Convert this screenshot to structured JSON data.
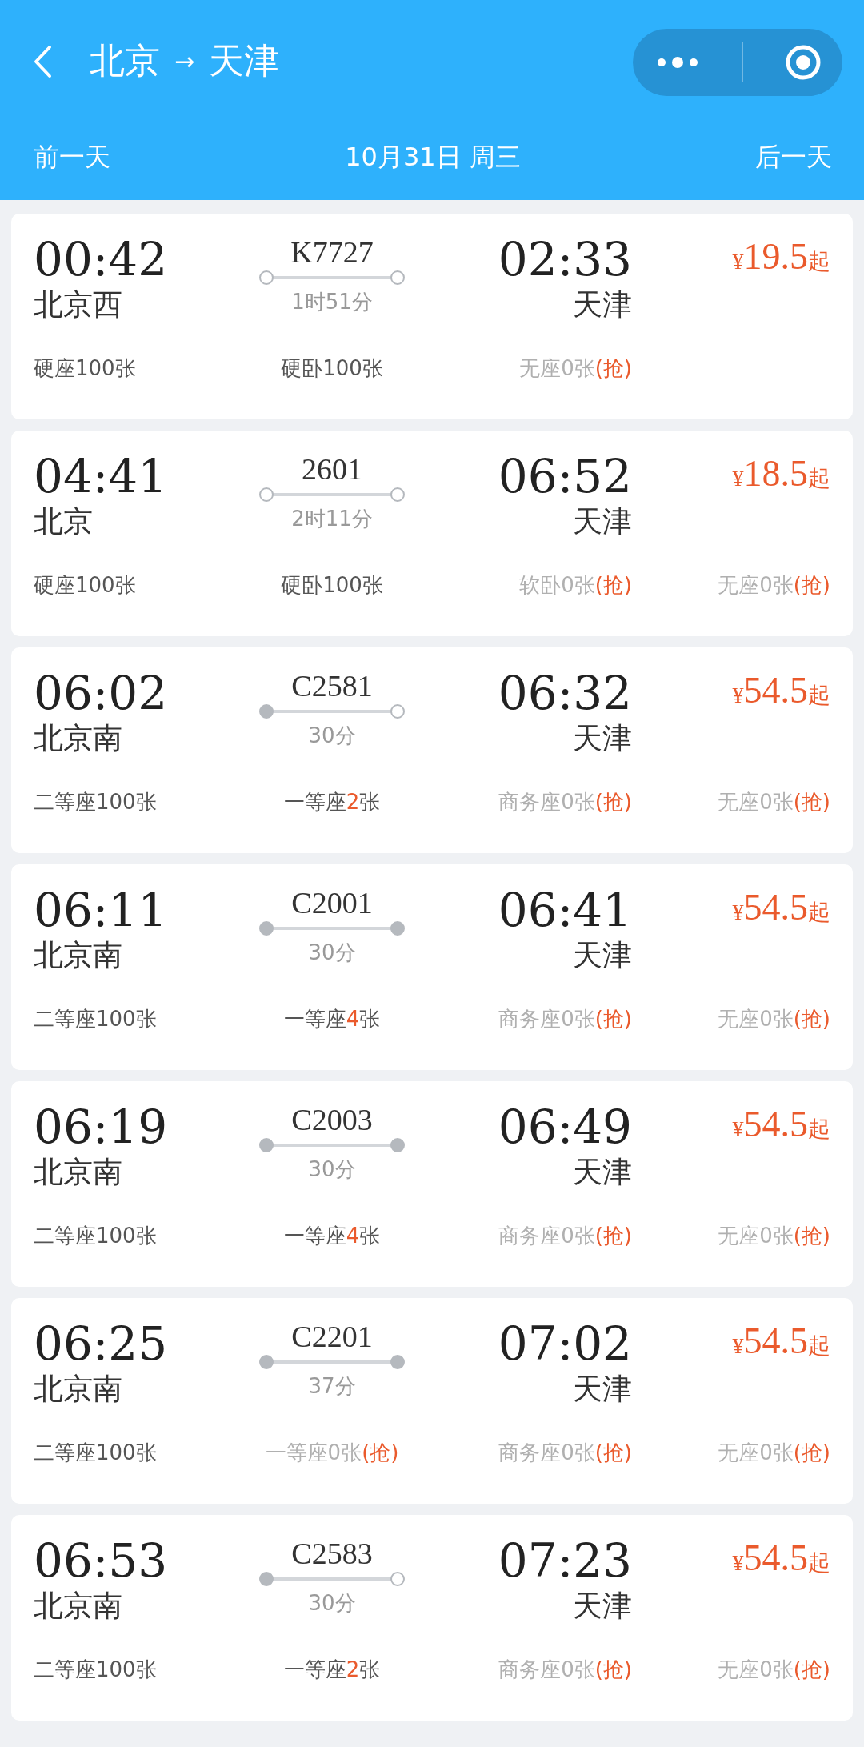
{
  "header": {
    "from": "北京",
    "arrow": "→",
    "to": "天津"
  },
  "date_bar": {
    "prev": "前一天",
    "date": "10月31日 周三",
    "next": "后一天"
  },
  "trains": [
    {
      "depart": "00:42",
      "from": "北京西",
      "train_no": "K7727",
      "duration": "1时51分",
      "arrive": "02:33",
      "to": "天津",
      "currency": "¥",
      "price": "19.5",
      "suffix": "起",
      "origin_station": false,
      "terminal_station": false,
      "seats": [
        {
          "name": "硬座",
          "count": "100",
          "unit": "张",
          "few": false,
          "sold_out": false
        },
        {
          "name": "硬卧",
          "count": "100",
          "unit": "张",
          "few": false,
          "sold_out": false
        },
        {
          "name": "无座",
          "count": "0",
          "unit": "张",
          "few": false,
          "sold_out": true,
          "action": "(抢)"
        }
      ]
    },
    {
      "depart": "04:41",
      "from": "北京",
      "train_no": "2601",
      "duration": "2时11分",
      "arrive": "06:52",
      "to": "天津",
      "currency": "¥",
      "price": "18.5",
      "suffix": "起",
      "origin_station": false,
      "terminal_station": false,
      "seats": [
        {
          "name": "硬座",
          "count": "100",
          "unit": "张",
          "few": false,
          "sold_out": false
        },
        {
          "name": "硬卧",
          "count": "100",
          "unit": "张",
          "few": false,
          "sold_out": false
        },
        {
          "name": "软卧",
          "count": "0",
          "unit": "张",
          "few": false,
          "sold_out": true,
          "action": "(抢)"
        },
        {
          "name": "无座",
          "count": "0",
          "unit": "张",
          "few": false,
          "sold_out": true,
          "action": "(抢)"
        }
      ]
    },
    {
      "depart": "06:02",
      "from": "北京南",
      "train_no": "C2581",
      "duration": "30分",
      "arrive": "06:32",
      "to": "天津",
      "currency": "¥",
      "price": "54.5",
      "suffix": "起",
      "origin_station": true,
      "terminal_station": false,
      "seats": [
        {
          "name": "二等座",
          "count": "100",
          "unit": "张",
          "few": false,
          "sold_out": false
        },
        {
          "name": "一等座",
          "count": "2",
          "unit": "张",
          "few": true,
          "sold_out": false
        },
        {
          "name": "商务座",
          "count": "0",
          "unit": "张",
          "few": false,
          "sold_out": true,
          "action": "(抢)"
        },
        {
          "name": "无座",
          "count": "0",
          "unit": "张",
          "few": false,
          "sold_out": true,
          "action": "(抢)"
        }
      ]
    },
    {
      "depart": "06:11",
      "from": "北京南",
      "train_no": "C2001",
      "duration": "30分",
      "arrive": "06:41",
      "to": "天津",
      "currency": "¥",
      "price": "54.5",
      "suffix": "起",
      "origin_station": true,
      "terminal_station": true,
      "seats": [
        {
          "name": "二等座",
          "count": "100",
          "unit": "张",
          "few": false,
          "sold_out": false
        },
        {
          "name": "一等座",
          "count": "4",
          "unit": "张",
          "few": true,
          "sold_out": false
        },
        {
          "name": "商务座",
          "count": "0",
          "unit": "张",
          "few": false,
          "sold_out": true,
          "action": "(抢)"
        },
        {
          "name": "无座",
          "count": "0",
          "unit": "张",
          "few": false,
          "sold_out": true,
          "action": "(抢)"
        }
      ]
    },
    {
      "depart": "06:19",
      "from": "北京南",
      "train_no": "C2003",
      "duration": "30分",
      "arrive": "06:49",
      "to": "天津",
      "currency": "¥",
      "price": "54.5",
      "suffix": "起",
      "origin_station": true,
      "terminal_station": true,
      "seats": [
        {
          "name": "二等座",
          "count": "100",
          "unit": "张",
          "few": false,
          "sold_out": false
        },
        {
          "name": "一等座",
          "count": "4",
          "unit": "张",
          "few": true,
          "sold_out": false
        },
        {
          "name": "商务座",
          "count": "0",
          "unit": "张",
          "few": false,
          "sold_out": true,
          "action": "(抢)"
        },
        {
          "name": "无座",
          "count": "0",
          "unit": "张",
          "few": false,
          "sold_out": true,
          "action": "(抢)"
        }
      ]
    },
    {
      "depart": "06:25",
      "from": "北京南",
      "train_no": "C2201",
      "duration": "37分",
      "arrive": "07:02",
      "to": "天津",
      "currency": "¥",
      "price": "54.5",
      "suffix": "起",
      "origin_station": true,
      "terminal_station": true,
      "seats": [
        {
          "name": "二等座",
          "count": "100",
          "unit": "张",
          "few": false,
          "sold_out": false
        },
        {
          "name": "一等座",
          "count": "0",
          "unit": "张",
          "few": false,
          "sold_out": true,
          "action": "(抢)"
        },
        {
          "name": "商务座",
          "count": "0",
          "unit": "张",
          "few": false,
          "sold_out": true,
          "action": "(抢)"
        },
        {
          "name": "无座",
          "count": "0",
          "unit": "张",
          "few": false,
          "sold_out": true,
          "action": "(抢)"
        }
      ]
    },
    {
      "depart": "06:53",
      "from": "北京南",
      "train_no": "C2583",
      "duration": "30分",
      "arrive": "07:23",
      "to": "天津",
      "currency": "¥",
      "price": "54.5",
      "suffix": "起",
      "origin_station": true,
      "terminal_station": false,
      "seats": [
        {
          "name": "二等座",
          "count": "100",
          "unit": "张",
          "few": false,
          "sold_out": false
        },
        {
          "name": "一等座",
          "count": "2",
          "unit": "张",
          "few": true,
          "sold_out": false
        },
        {
          "name": "商务座",
          "count": "0",
          "unit": "张",
          "few": false,
          "sold_out": true,
          "action": "(抢)"
        },
        {
          "name": "无座",
          "count": "0",
          "unit": "张",
          "few": false,
          "sold_out": true,
          "action": "(抢)"
        }
      ]
    }
  ]
}
